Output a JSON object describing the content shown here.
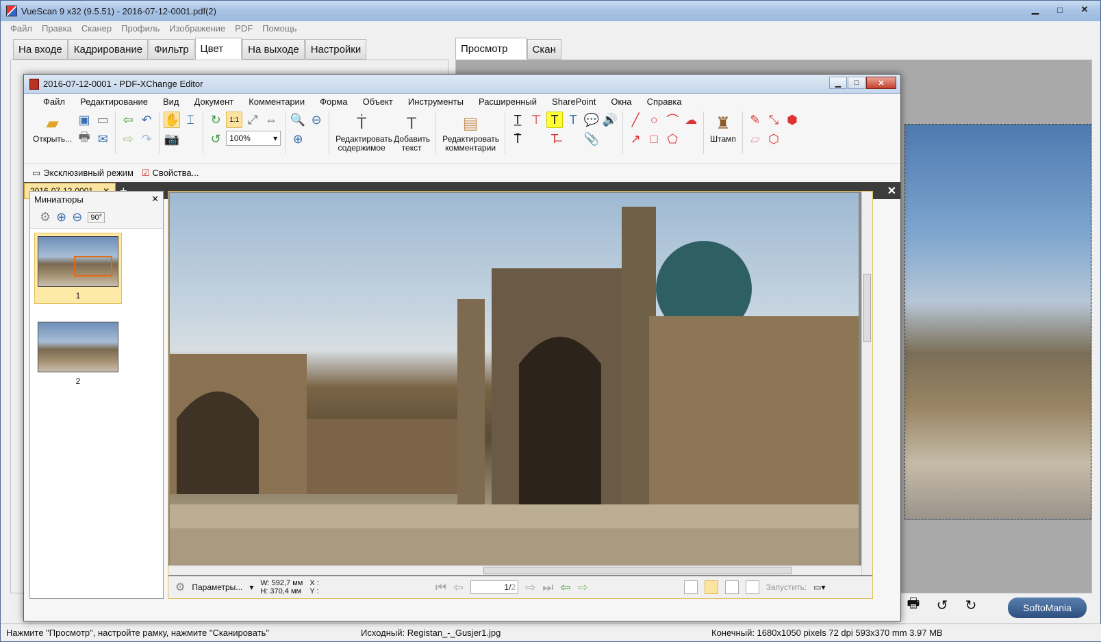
{
  "vuescan": {
    "title": "VueScan 9 x32 (9.5.51) - 2016-07-12-0001.pdf(2)",
    "menu": [
      "Файл",
      "Правка",
      "Сканер",
      "Профиль",
      "Изображение",
      "PDF",
      "Помощь"
    ],
    "tabs_left": [
      "На входе",
      "Кадрирование",
      "Фильтр",
      "Цвет",
      "На выходе",
      "Настройки"
    ],
    "active_tab_left": "Цвет",
    "tabs_right": [
      "Просмотр",
      "Скан"
    ],
    "active_tab_right": "Просмотр",
    "window_controls": {
      "minimize": "▁",
      "maximize": "□",
      "close": "✕"
    },
    "status": {
      "hint": "Нажмите \"Просмотр\", настройте рамку, нажмите \"Сканировать\"",
      "source": "Исходный: Registan_-_Gusjer1.jpg",
      "output": "Конечный: 1680x1050 pixels 72 dpi 593x370 mm 3.97 MB"
    },
    "watermark": "SoftoMania"
  },
  "pdfx": {
    "title": "2016-07-12-0001 - PDF-XChange Editor",
    "menu": [
      "Файл",
      "Редактирование",
      "Вид",
      "Документ",
      "Комментарии",
      "Форма",
      "Объект",
      "Инструменты",
      "Расширенный",
      "SharePoint",
      "Окна",
      "Справка"
    ],
    "toolbar": {
      "open": "Открыть...",
      "zoom": "100%",
      "edit_content": "Редактировать содержимое",
      "add_text": "Добавить текст",
      "edit_comments": "Редактировать комментарии",
      "stamp": "Штамп"
    },
    "toolbar2": {
      "exclusive": "Эксклюзивный режим",
      "properties": "Свойства..."
    },
    "doc_tab": "2016-07-12-0001",
    "sidebar": {
      "title": "Миниатюры",
      "thumbs": [
        {
          "label": "1"
        },
        {
          "label": "2"
        }
      ]
    },
    "statusbar": {
      "params": "Параметры...",
      "width": "W: 592,7 мм",
      "height": "H: 370,4 мм",
      "x": "X :",
      "y": "Y :",
      "page": "1",
      "page_total": "2",
      "launch": "Запустить:"
    }
  },
  "colors": {
    "accent_tab": "#fbe3a0",
    "title_bar": "#c4d6ec",
    "selection_rect": "#e06a1a"
  }
}
